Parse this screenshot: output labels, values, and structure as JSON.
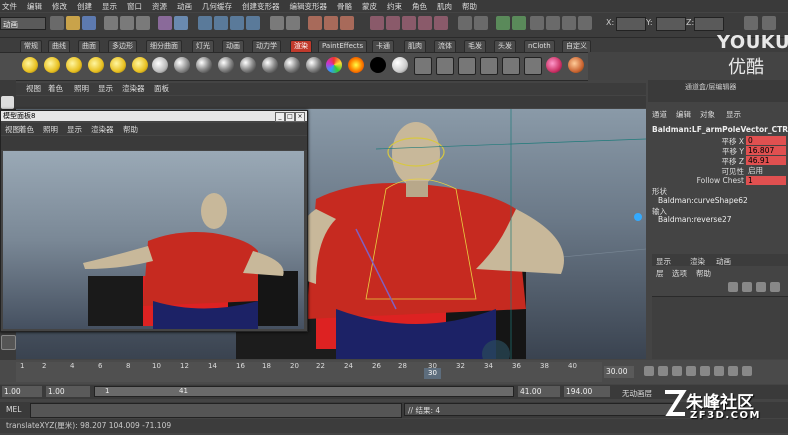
{
  "menubar": [
    "文件",
    "编辑",
    "修改",
    "创建",
    "显示",
    "窗口",
    "资源",
    "动画",
    "几何缓存",
    "创建变形器",
    "编辑变形器",
    "骨骼",
    "蒙皮",
    "约束",
    "角色",
    "肌肉",
    "帮助"
  ],
  "status": {
    "mode": "动画",
    "x_label": "X:",
    "y_label": "Y:",
    "z_label": "Z:"
  },
  "brand": {
    "youku": "YOUKU",
    "youku_sub": "优酷"
  },
  "shelf": {
    "tabs": [
      "常规",
      "曲线",
      "曲面",
      "多边形",
      "细分曲面",
      "灯光",
      "动画",
      "动力学",
      "渲染",
      "PaintEffects",
      "卡通",
      "肌肉",
      "流体",
      "毛发",
      "头发",
      "nCloth",
      "自定义"
    ],
    "active_tab": "渲染"
  },
  "viewport": {
    "menu": [
      "视图",
      "着色",
      "照明",
      "显示",
      "渲染器",
      "面板"
    ]
  },
  "float_panel": {
    "title": "模型面板8",
    "menu": [
      "视图",
      "着色",
      "照明",
      "显示",
      "渲染器",
      "帮助"
    ],
    "minimize": "_",
    "maximize": "□",
    "close": "×"
  },
  "channel_box": {
    "header": "通道盒/层编辑器",
    "menu": [
      "通道",
      "编辑",
      "对象",
      "显示"
    ],
    "node": "Baldman:LF_armPoleVector_CTRL",
    "attrs": [
      {
        "name": "平移 X",
        "value": "0",
        "color": "#e05050"
      },
      {
        "name": "平移 Y",
        "value": "16.807",
        "color": "#e05050"
      },
      {
        "name": "平移 Z",
        "value": "46.91",
        "color": "#e05050"
      },
      {
        "name": "可见性",
        "value": "启用",
        "color": ""
      },
      {
        "name": "Follow Chest",
        "value": "1",
        "color": "#e05050"
      }
    ],
    "shapes_label": "形状",
    "shape": "Baldman:curveShape62",
    "inputs_label": "输入",
    "input": "Baldman:reverse27"
  },
  "layer_editor": {
    "tabs": [
      "显示",
      "渲染",
      "动画"
    ],
    "menu": [
      "层",
      "选项",
      "帮助"
    ]
  },
  "timeline": {
    "ticks": [
      "1",
      "2",
      "4",
      "6",
      "8",
      "10",
      "12",
      "14",
      "16",
      "18",
      "20",
      "22",
      "24",
      "26",
      "28",
      "30",
      "32",
      "34",
      "36",
      "38",
      "40"
    ],
    "current": "30",
    "end": "30.00"
  },
  "range": {
    "start": "1.00",
    "start2": "1.00",
    "slider_start": "1",
    "slider_end": "41",
    "end": "41.00",
    "end2": "194.00",
    "char_set": "无动画层"
  },
  "cmd": {
    "label": "MEL",
    "result": "// 结果: 4"
  },
  "help": "translateXYZ(厘米): 98.207  104.009  -71.109",
  "watermark": {
    "text": "朱峰社区",
    "sub": "ZF3D.COM"
  }
}
